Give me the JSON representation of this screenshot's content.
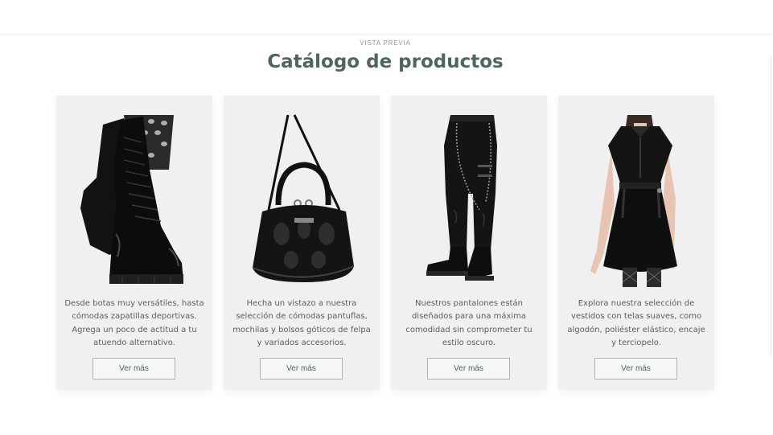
{
  "section": {
    "eyebrow": "VISTA PREVIA",
    "title": "Catálogo de productos"
  },
  "colors": {
    "title": "#4e6562",
    "card_background": "#f0f0f1",
    "button_border": "#a9b6b4",
    "body_text": "#5c5c5c"
  },
  "cards": [
    {
      "image": "black-combat-boots",
      "description": "Desde botas muy versátiles, hasta cómodas zapatillas deportivas. Agrega un poco de actitud a tu atuendo alternativo.",
      "button_label": "Ver más"
    },
    {
      "image": "black-gothic-handbag",
      "description": "Hecha un vistazo a nuestra selección de cómodas pantuflas, mochilas y bolsos góticos de felpa y variados accesorios.",
      "button_label": "Ver más"
    },
    {
      "image": "black-chain-pants",
      "description": "Nuestros pantalones están diseñados para una máxima comodidad sin comprometer tu estilo oscuro.",
      "button_label": "Ver más"
    },
    {
      "image": "black-gothic-dress",
      "description": "Explora nuestra selección de vestidos con telas suaves, como algodón, poliéster elástico, encaje y terciopelo.",
      "button_label": "Ver más"
    }
  ]
}
